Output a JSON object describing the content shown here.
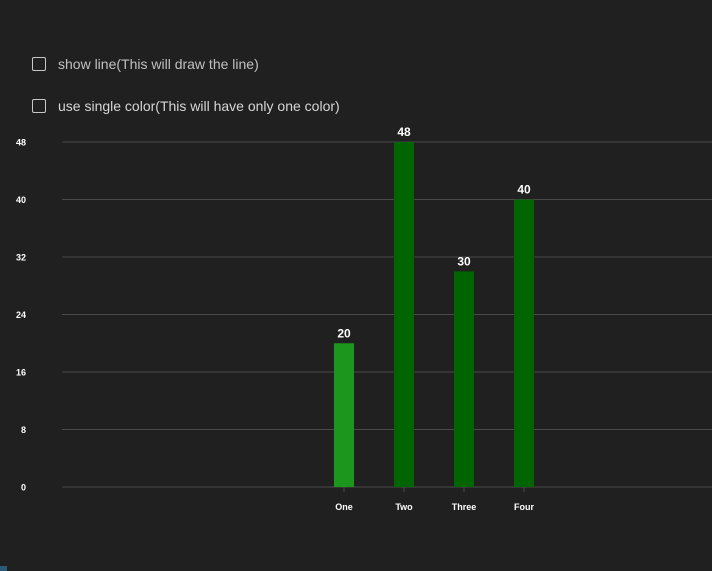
{
  "options": [
    {
      "label": "show line(This will draw the line)",
      "checked": false
    },
    {
      "label": "use single color(This will have only one color)",
      "checked": false
    }
  ],
  "colors": {
    "background": "#202020",
    "grid": "#4a4a4a",
    "axis_text": "#ffffff",
    "bar_light": "#1c961c",
    "bar_dark": "#006400"
  },
  "chart_data": {
    "type": "bar",
    "categories": [
      "One",
      "Two",
      "Three",
      "Four"
    ],
    "values": [
      20,
      48,
      30,
      40
    ],
    "bar_colors": [
      "#1c961c",
      "#006400",
      "#006400",
      "#006400"
    ],
    "yticks": [
      0,
      8,
      16,
      24,
      32,
      40,
      48
    ],
    "ylim": [
      0,
      48
    ],
    "grid": true,
    "data_labels": true,
    "title": "",
    "xlabel": "",
    "ylabel": ""
  }
}
